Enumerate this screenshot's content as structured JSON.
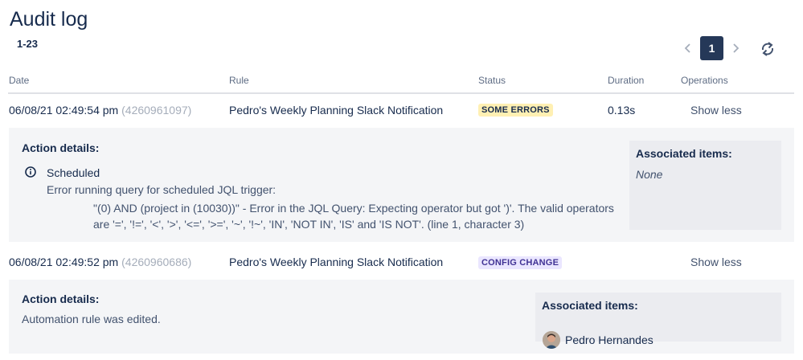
{
  "page": {
    "title": "Audit log",
    "range": "1-23"
  },
  "pager": {
    "current_page": "1",
    "prev_icon": "chevron-left-icon",
    "next_icon": "chevron-right-icon",
    "refresh_icon": "refresh-icon"
  },
  "columns": {
    "date": "Date",
    "rule": "Rule",
    "status": "Status",
    "duration": "Duration",
    "operations": "Operations"
  },
  "rows": [
    {
      "date": "06/08/21 02:49:54 pm",
      "id": "(4260961097)",
      "rule": "Pedro's Weekly Planning Slack Notification",
      "status": "SOME ERRORS",
      "duration": "0.13s",
      "operation": "Show less",
      "details": {
        "heading": "Action details:",
        "event": "Scheduled",
        "error_intro": "Error running query for scheduled JQL trigger:",
        "error_message": "\"(0) AND (project in (10030))\" - Error in the JQL Query: Expecting operator but got ')'. The valid operators are '=', '!=', '<', '>', '<=', '>=', '~', '!~', 'IN', 'NOT IN', 'IS' and 'IS NOT'. (line 1, character 3)"
      },
      "associated": {
        "heading": "Associated items:",
        "value": "None"
      }
    },
    {
      "date": "06/08/21 02:49:52 pm",
      "id": "(4260960686)",
      "rule": "Pedro's Weekly Planning Slack Notification",
      "status": "CONFIG CHANGE",
      "duration": "",
      "operation": "Show less",
      "details": {
        "heading": "Action details:",
        "message": "Automation rule was edited."
      },
      "associated": {
        "heading": "Associated items:",
        "user": "Pedro Hernandes"
      }
    }
  ],
  "colors": {
    "accent": "#253858",
    "some_errors_bg": "#fff0b3",
    "config_change_bg": "#eae6ff",
    "config_change_text": "#403294",
    "panel_bg": "#f4f5f7"
  }
}
